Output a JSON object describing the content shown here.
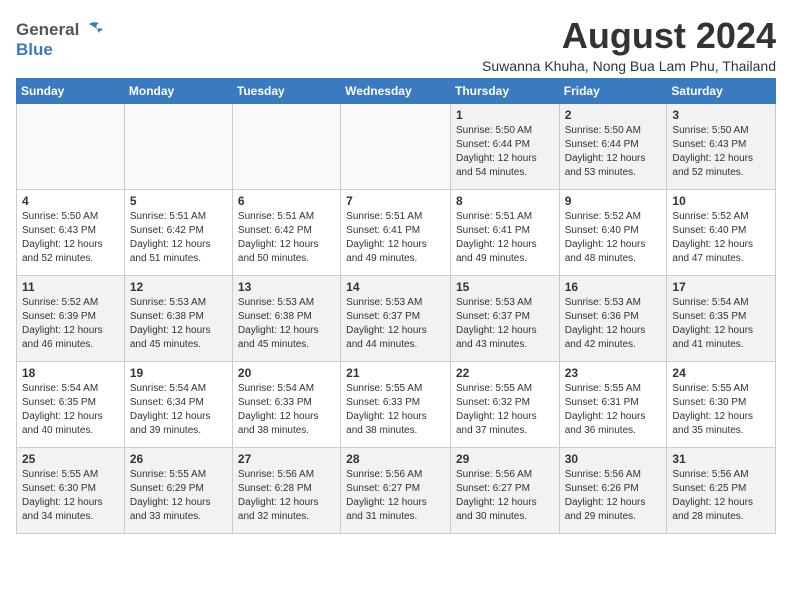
{
  "header": {
    "logo_general": "General",
    "logo_blue": "Blue",
    "month_title": "August 2024",
    "location": "Suwanna Khuha, Nong Bua Lam Phu, Thailand"
  },
  "days_of_week": [
    "Sunday",
    "Monday",
    "Tuesday",
    "Wednesday",
    "Thursday",
    "Friday",
    "Saturday"
  ],
  "weeks": [
    [
      {
        "day": "",
        "info": ""
      },
      {
        "day": "",
        "info": ""
      },
      {
        "day": "",
        "info": ""
      },
      {
        "day": "",
        "info": ""
      },
      {
        "day": "1",
        "info": "Sunrise: 5:50 AM\nSunset: 6:44 PM\nDaylight: 12 hours\nand 54 minutes."
      },
      {
        "day": "2",
        "info": "Sunrise: 5:50 AM\nSunset: 6:44 PM\nDaylight: 12 hours\nand 53 minutes."
      },
      {
        "day": "3",
        "info": "Sunrise: 5:50 AM\nSunset: 6:43 PM\nDaylight: 12 hours\nand 52 minutes."
      }
    ],
    [
      {
        "day": "4",
        "info": "Sunrise: 5:50 AM\nSunset: 6:43 PM\nDaylight: 12 hours\nand 52 minutes."
      },
      {
        "day": "5",
        "info": "Sunrise: 5:51 AM\nSunset: 6:42 PM\nDaylight: 12 hours\nand 51 minutes."
      },
      {
        "day": "6",
        "info": "Sunrise: 5:51 AM\nSunset: 6:42 PM\nDaylight: 12 hours\nand 50 minutes."
      },
      {
        "day": "7",
        "info": "Sunrise: 5:51 AM\nSunset: 6:41 PM\nDaylight: 12 hours\nand 49 minutes."
      },
      {
        "day": "8",
        "info": "Sunrise: 5:51 AM\nSunset: 6:41 PM\nDaylight: 12 hours\nand 49 minutes."
      },
      {
        "day": "9",
        "info": "Sunrise: 5:52 AM\nSunset: 6:40 PM\nDaylight: 12 hours\nand 48 minutes."
      },
      {
        "day": "10",
        "info": "Sunrise: 5:52 AM\nSunset: 6:40 PM\nDaylight: 12 hours\nand 47 minutes."
      }
    ],
    [
      {
        "day": "11",
        "info": "Sunrise: 5:52 AM\nSunset: 6:39 PM\nDaylight: 12 hours\nand 46 minutes."
      },
      {
        "day": "12",
        "info": "Sunrise: 5:53 AM\nSunset: 6:38 PM\nDaylight: 12 hours\nand 45 minutes."
      },
      {
        "day": "13",
        "info": "Sunrise: 5:53 AM\nSunset: 6:38 PM\nDaylight: 12 hours\nand 45 minutes."
      },
      {
        "day": "14",
        "info": "Sunrise: 5:53 AM\nSunset: 6:37 PM\nDaylight: 12 hours\nand 44 minutes."
      },
      {
        "day": "15",
        "info": "Sunrise: 5:53 AM\nSunset: 6:37 PM\nDaylight: 12 hours\nand 43 minutes."
      },
      {
        "day": "16",
        "info": "Sunrise: 5:53 AM\nSunset: 6:36 PM\nDaylight: 12 hours\nand 42 minutes."
      },
      {
        "day": "17",
        "info": "Sunrise: 5:54 AM\nSunset: 6:35 PM\nDaylight: 12 hours\nand 41 minutes."
      }
    ],
    [
      {
        "day": "18",
        "info": "Sunrise: 5:54 AM\nSunset: 6:35 PM\nDaylight: 12 hours\nand 40 minutes."
      },
      {
        "day": "19",
        "info": "Sunrise: 5:54 AM\nSunset: 6:34 PM\nDaylight: 12 hours\nand 39 minutes."
      },
      {
        "day": "20",
        "info": "Sunrise: 5:54 AM\nSunset: 6:33 PM\nDaylight: 12 hours\nand 38 minutes."
      },
      {
        "day": "21",
        "info": "Sunrise: 5:55 AM\nSunset: 6:33 PM\nDaylight: 12 hours\nand 38 minutes."
      },
      {
        "day": "22",
        "info": "Sunrise: 5:55 AM\nSunset: 6:32 PM\nDaylight: 12 hours\nand 37 minutes."
      },
      {
        "day": "23",
        "info": "Sunrise: 5:55 AM\nSunset: 6:31 PM\nDaylight: 12 hours\nand 36 minutes."
      },
      {
        "day": "24",
        "info": "Sunrise: 5:55 AM\nSunset: 6:30 PM\nDaylight: 12 hours\nand 35 minutes."
      }
    ],
    [
      {
        "day": "25",
        "info": "Sunrise: 5:55 AM\nSunset: 6:30 PM\nDaylight: 12 hours\nand 34 minutes."
      },
      {
        "day": "26",
        "info": "Sunrise: 5:55 AM\nSunset: 6:29 PM\nDaylight: 12 hours\nand 33 minutes."
      },
      {
        "day": "27",
        "info": "Sunrise: 5:56 AM\nSunset: 6:28 PM\nDaylight: 12 hours\nand 32 minutes."
      },
      {
        "day": "28",
        "info": "Sunrise: 5:56 AM\nSunset: 6:27 PM\nDaylight: 12 hours\nand 31 minutes."
      },
      {
        "day": "29",
        "info": "Sunrise: 5:56 AM\nSunset: 6:27 PM\nDaylight: 12 hours\nand 30 minutes."
      },
      {
        "day": "30",
        "info": "Sunrise: 5:56 AM\nSunset: 6:26 PM\nDaylight: 12 hours\nand 29 minutes."
      },
      {
        "day": "31",
        "info": "Sunrise: 5:56 AM\nSunset: 6:25 PM\nDaylight: 12 hours\nand 28 minutes."
      }
    ]
  ]
}
